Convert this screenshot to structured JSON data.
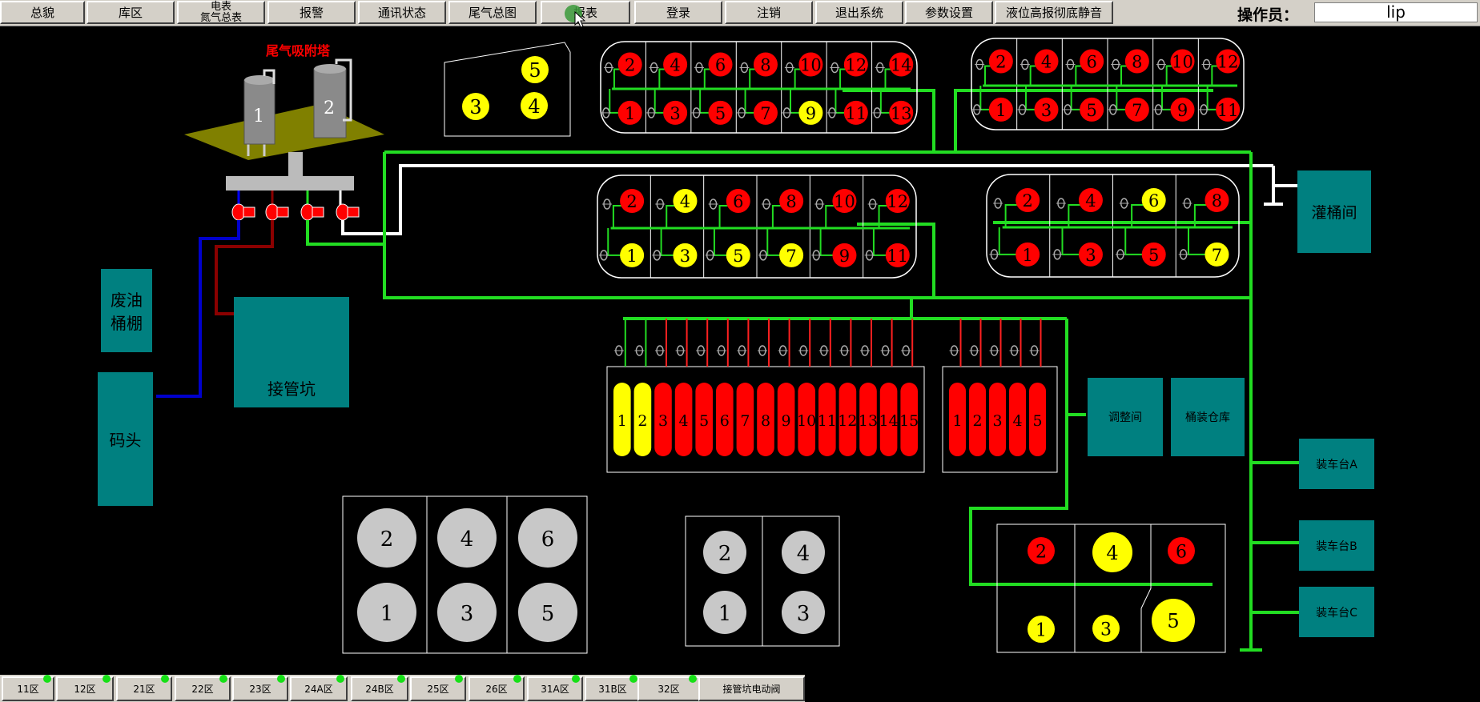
{
  "toolbar": {
    "buttons": [
      "总貌",
      "库区",
      "电表\n氮气总表",
      "报警",
      "通讯状态",
      "尾气总图",
      "报表",
      "登录",
      "注销",
      "退出系统",
      "参数设置",
      "液位高报彻底静音"
    ],
    "operator_label": "操作员：",
    "operator_value": "lip"
  },
  "zone_tabs": [
    "11区",
    "12区",
    "21区",
    "22区",
    "23区",
    "24A区",
    "24B区",
    "25区",
    "26区",
    "31A区",
    "31B区",
    "32区",
    "接管坑电动阀"
  ],
  "labels": {
    "adsorption_tower": "尾气吸附塔",
    "waste_oil_shed": "废油\n桶棚",
    "dock": "码头",
    "pipe_pit": "接管坑",
    "filling_room": "灌桶间",
    "adjust_room": "调整间",
    "barrel_warehouse": "桶装仓库",
    "loading_a": "装车台A",
    "loading_b": "装车台B",
    "loading_c": "装车台C"
  },
  "adsorption_towers": [
    "1",
    "2"
  ],
  "colors": {
    "pipe_green": "#22dd22",
    "pipe_white": "#ffffff",
    "pipe_blue": "#0000cc",
    "pipe_darkred": "#8b0000",
    "tank_red": "#ff0000",
    "tank_yellow": "#ffff00",
    "tank_gray": "#c0c0c0",
    "building_teal": "#008080"
  }
}
